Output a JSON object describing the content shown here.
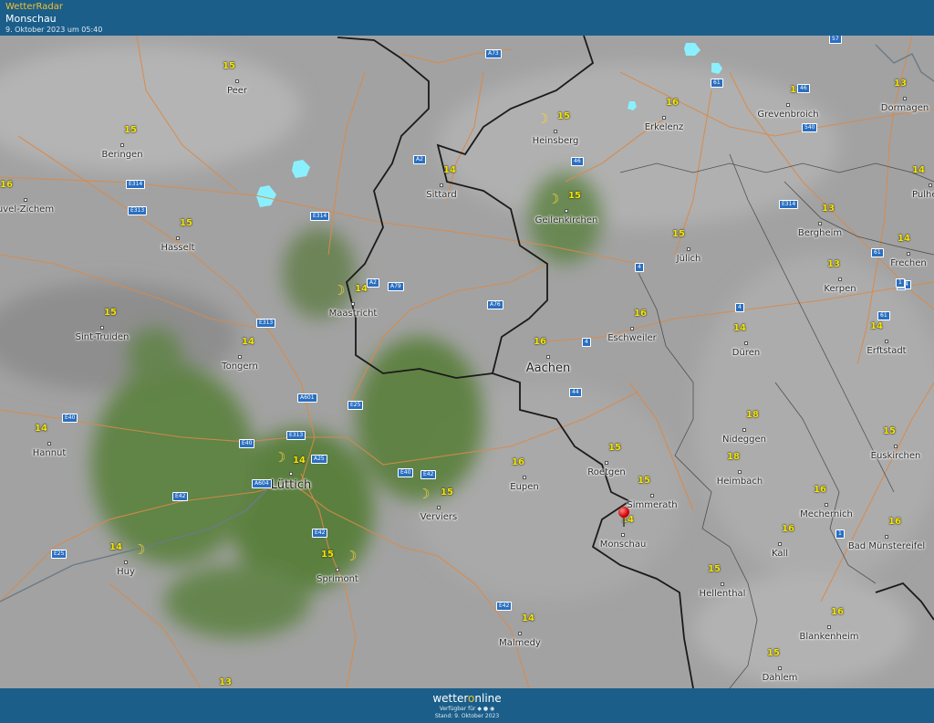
{
  "header": {
    "brand": "WetterRadar",
    "location": "Monschau",
    "timestamp": "9. Oktober 2023 um 05:40"
  },
  "footer": {
    "logo_a": "wetter",
    "logo_b": "o",
    "logo_c": "nline",
    "available": "Verfügbar für ◆ ● ◉",
    "stand": "Stand: 9. Oktober 2023"
  },
  "colors": {
    "bar": "#1b5e8a",
    "brand_text": "#f2c12e",
    "temperature": "#f4e600",
    "road_lines": "#d98a4a",
    "border_lines": "#1a1a1a",
    "radar_green": "#4f7a2f",
    "radar_light": "#8af0ff",
    "marker": "#d10000"
  },
  "cities": [
    {
      "name": "Peer",
      "temp": "15",
      "big": false
    },
    {
      "name": "Beringen",
      "temp": "15",
      "big": false
    },
    {
      "name": "uvel-Zichem",
      "temp": "16",
      "big": false
    },
    {
      "name": "Hasselt",
      "temp": "15",
      "big": false
    },
    {
      "name": "Sint-Truiden",
      "temp": "15",
      "big": false
    },
    {
      "name": "Tongern",
      "temp": "14",
      "big": false
    },
    {
      "name": "Hannut",
      "temp": "14",
      "big": false
    },
    {
      "name": "Lüttich",
      "temp": "14",
      "big": true
    },
    {
      "name": "Huy",
      "temp": "14",
      "big": false
    },
    {
      "name": "Sprimont",
      "temp": "15",
      "big": false
    },
    {
      "name": "Maastricht",
      "temp": "14",
      "big": false
    },
    {
      "name": "Sittard",
      "temp": "14",
      "big": false
    },
    {
      "name": "Heinsberg",
      "temp": "15",
      "big": false
    },
    {
      "name": "Geilenkirchen",
      "temp": "15",
      "big": false
    },
    {
      "name": "Erkelenz",
      "temp": "16",
      "big": false
    },
    {
      "name": "Grevenbroich",
      "temp": "15",
      "big": false
    },
    {
      "name": "Dormagen",
      "temp": "13",
      "big": false
    },
    {
      "name": "Pulheim",
      "temp": "14",
      "big": false
    },
    {
      "name": "Bergheim",
      "temp": "13",
      "big": false
    },
    {
      "name": "Frechen",
      "temp": "14",
      "big": false
    },
    {
      "name": "Kerpen",
      "temp": "13",
      "big": false
    },
    {
      "name": "Jülich",
      "temp": "15",
      "big": false
    },
    {
      "name": "Eschweiler",
      "temp": "16",
      "big": false
    },
    {
      "name": "Düren",
      "temp": "14",
      "big": false
    },
    {
      "name": "Erftstadt",
      "temp": "14",
      "big": false
    },
    {
      "name": "Aachen",
      "temp": "16",
      "big": true
    },
    {
      "name": "Nideggen",
      "temp": "18",
      "big": false
    },
    {
      "name": "Euskirchen",
      "temp": "15",
      "big": false
    },
    {
      "name": "Heimbach",
      "temp": "18",
      "big": false
    },
    {
      "name": "Roetgen",
      "temp": "15",
      "big": false
    },
    {
      "name": "Simmerath",
      "temp": "15",
      "big": false
    },
    {
      "name": "Eupen",
      "temp": "16",
      "big": false
    },
    {
      "name": "Verviers",
      "temp": "15",
      "big": false
    },
    {
      "name": "Monschau",
      "temp": "14",
      "big": false
    },
    {
      "name": "Mechernich",
      "temp": "16",
      "big": false
    },
    {
      "name": "Kall",
      "temp": "16",
      "big": false
    },
    {
      "name": "Bad Münstereifel",
      "temp": "16",
      "big": false
    },
    {
      "name": "Hellenthal",
      "temp": "15",
      "big": false
    },
    {
      "name": "Blankenheim",
      "temp": "16",
      "big": false
    },
    {
      "name": "Malmedy",
      "temp": "14",
      "big": false
    },
    {
      "name": "Dahlem",
      "temp": "15",
      "big": false
    }
  ],
  "extra_temps": [
    "13"
  ],
  "roads": [
    "A73",
    "57",
    "61",
    "46",
    "540",
    "A2",
    "46",
    "E314",
    "E313",
    "E314",
    "E314",
    "61",
    "4",
    "44",
    "A2",
    "A79",
    "A76",
    "1",
    "E313",
    "4",
    "4",
    "61",
    "1",
    "E40",
    "A601",
    "E25",
    "E313",
    "44",
    "E40",
    "A25",
    "A604",
    "E40",
    "E42",
    "E42",
    "E25",
    "E42",
    "E42",
    "1",
    "1"
  ]
}
